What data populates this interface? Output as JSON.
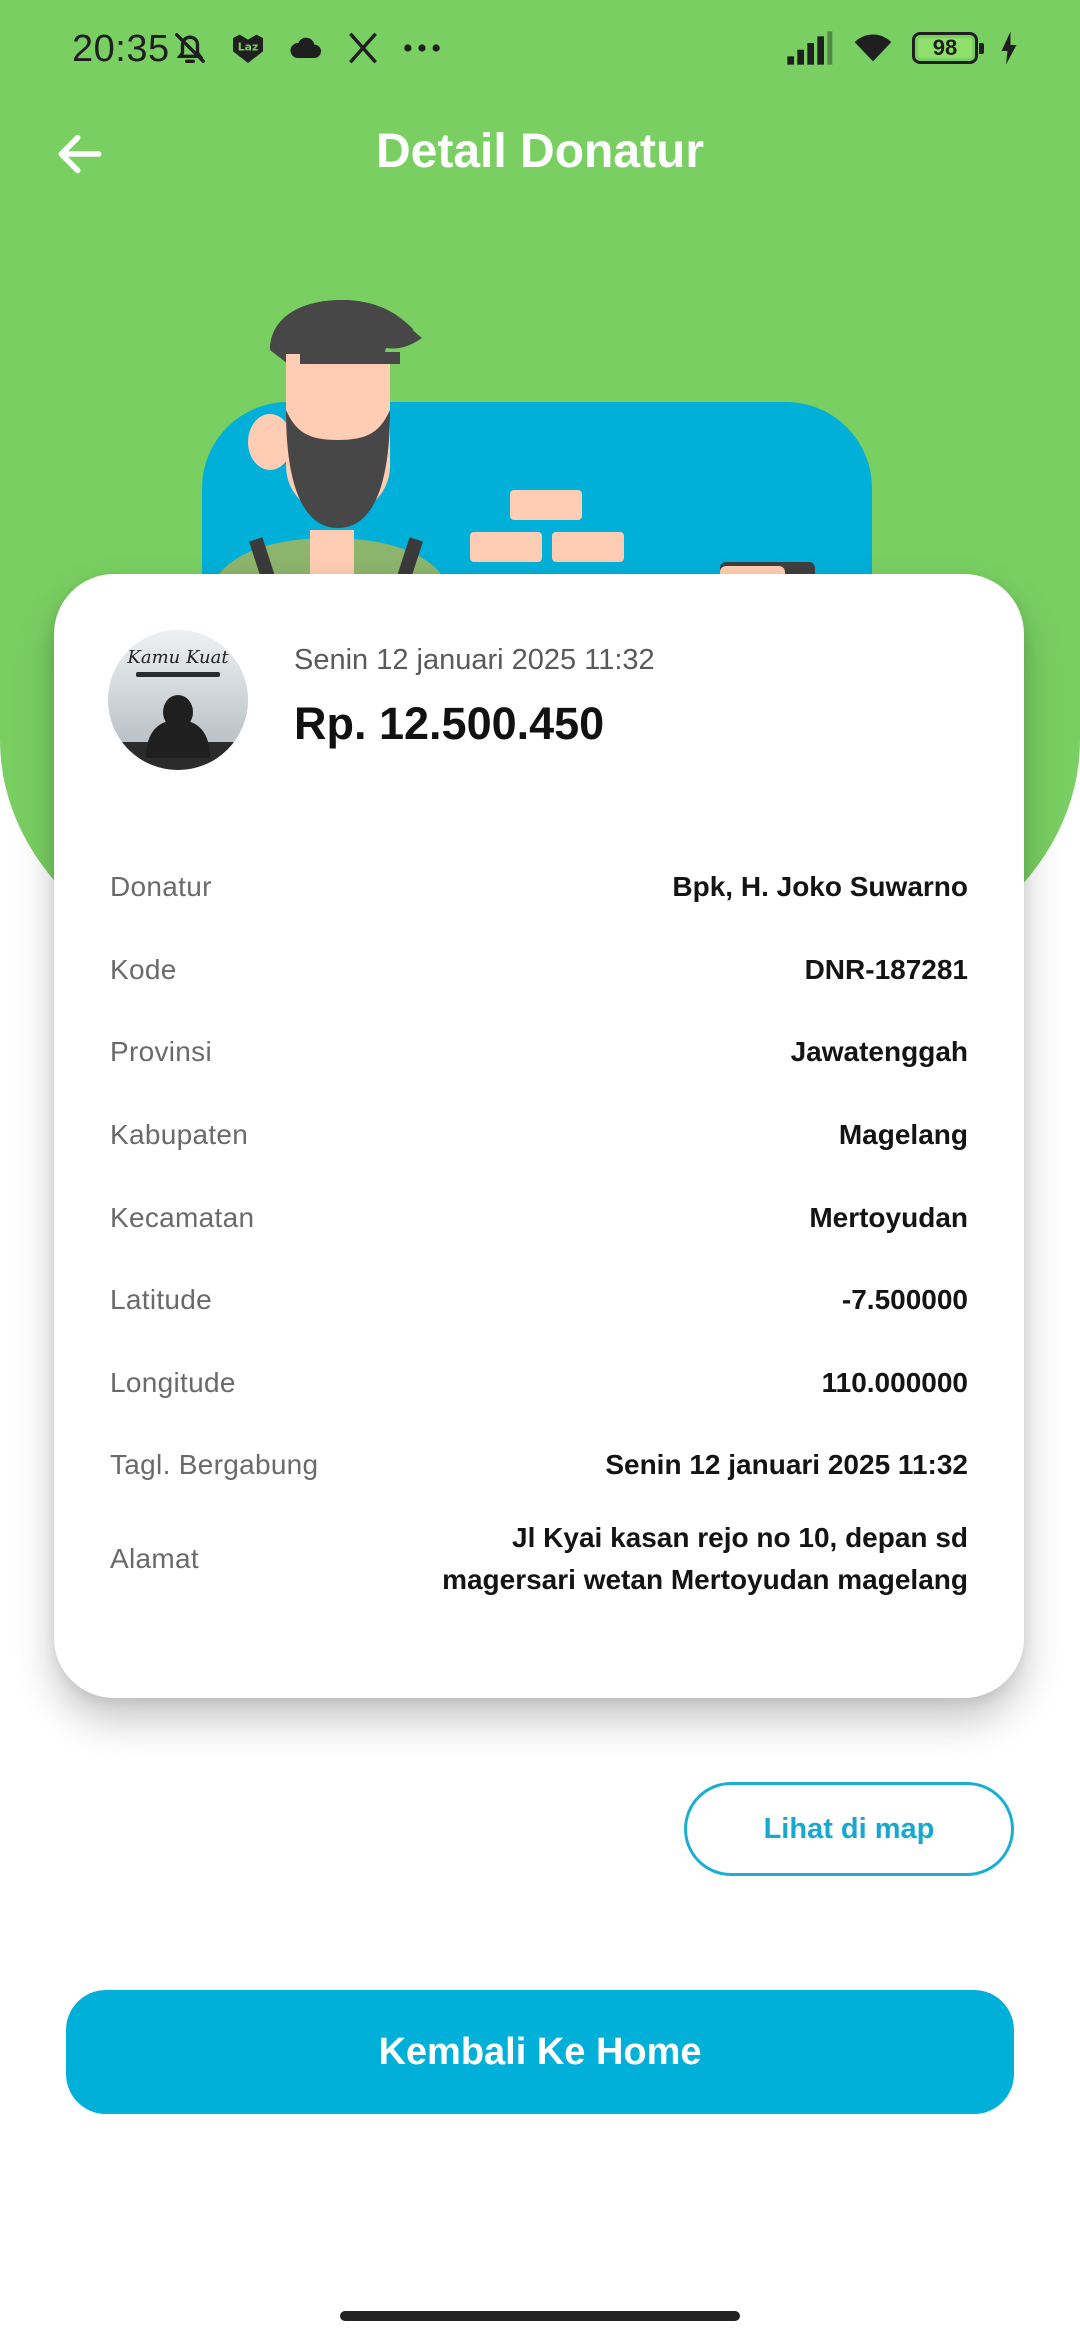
{
  "status_bar": {
    "time": "20:35",
    "battery_percent": "98",
    "left_icons": [
      "mute-bell-icon",
      "lazada-icon",
      "cloud-icon",
      "x-app-icon",
      "more-dots-icon"
    ],
    "right_icons": [
      "signal-icon",
      "wifi-icon",
      "battery-icon",
      "charging-bolt-icon"
    ]
  },
  "app_bar": {
    "title": "Detail Donatur",
    "back_icon": "arrow-left-icon"
  },
  "colors": {
    "header_green": "#79cf62",
    "accent_blue": "#00b0d8",
    "card_white": "#ffffff"
  },
  "card": {
    "avatar_text": "Kamu Kuat",
    "date": "Senin 12 januari 2025 11:32",
    "amount": "Rp. 12.500.450",
    "rows": [
      {
        "label": "Donatur",
        "value": "Bpk, H. Joko Suwarno"
      },
      {
        "label": "Kode",
        "value": "DNR-187281"
      },
      {
        "label": "Provinsi",
        "value": "Jawatenggah"
      },
      {
        "label": "Kabupaten",
        "value": "Magelang"
      },
      {
        "label": "Kecamatan",
        "value": "Mertoyudan"
      },
      {
        "label": "Latitude",
        "value": "-7.500000"
      },
      {
        "label": "Longitude",
        "value": "110.000000"
      },
      {
        "label": "Tagl. Bergabung",
        "value": "Senin 12 januari 2025 11:32"
      },
      {
        "label": "Alamat",
        "value": "Jl Kyai kasan rejo no 10, depan sd magersari wetan Mertoyudan magelang"
      }
    ]
  },
  "buttons": {
    "map": "Lihat di map",
    "home": "Kembali Ke Home"
  }
}
